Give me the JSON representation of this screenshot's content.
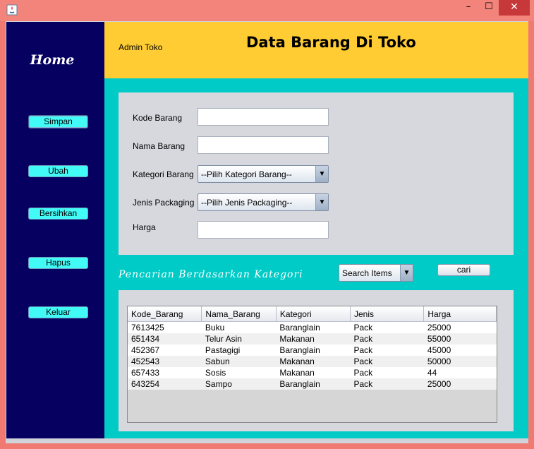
{
  "window": {
    "minimize_glyph": "–",
    "maximize_glyph": "☐",
    "close_glyph": "✕"
  },
  "sidebar": {
    "title": "Home",
    "buttons": [
      "Simpan",
      "Ubah",
      "Bersihkan",
      "Hapus",
      "Keluar"
    ]
  },
  "header": {
    "admin_label": "Admin Toko",
    "title": "Data Barang Di Toko"
  },
  "form": {
    "kode_label": "Kode Barang",
    "kode_value": "",
    "nama_label": "Nama Barang",
    "nama_value": "",
    "kategori_label": "Kategori Barang",
    "kategori_value": "--Pilih Kategori Barang--",
    "packaging_label": "Jenis Packaging",
    "packaging_value": "--Pilih Jenis Packaging--",
    "harga_label": "Harga",
    "harga_value": ""
  },
  "search": {
    "caption": "Pencarian Berdasarkan Kategori",
    "combo_value": "Search Items",
    "button_label": "cari"
  },
  "table": {
    "columns": [
      "Kode_Barang",
      "Nama_Barang",
      "Kategori",
      "Jenis",
      "Harga"
    ],
    "rows": [
      [
        "7613425",
        "Buku",
        "Baranglain",
        "Pack",
        "25000"
      ],
      [
        "651434",
        "Telur Asin",
        "Makanan",
        "Pack",
        "55000"
      ],
      [
        "452367",
        "Pastagigi",
        "Baranglain",
        "Pack",
        "45000"
      ],
      [
        "452543",
        "Sabun",
        "Makanan",
        "Pack",
        "50000"
      ],
      [
        "657433",
        "Sosis",
        "Makanan",
        "Pack",
        "44"
      ],
      [
        "643254",
        "Sampo",
        "Baranglain",
        "Pack",
        "25000"
      ]
    ]
  },
  "colors": {
    "titlebar": "#f2847b",
    "sidebar": "#060060",
    "header": "#ffcc33",
    "main": "#00cbc6",
    "button": "#42fbf6",
    "close": "#c7383a"
  }
}
